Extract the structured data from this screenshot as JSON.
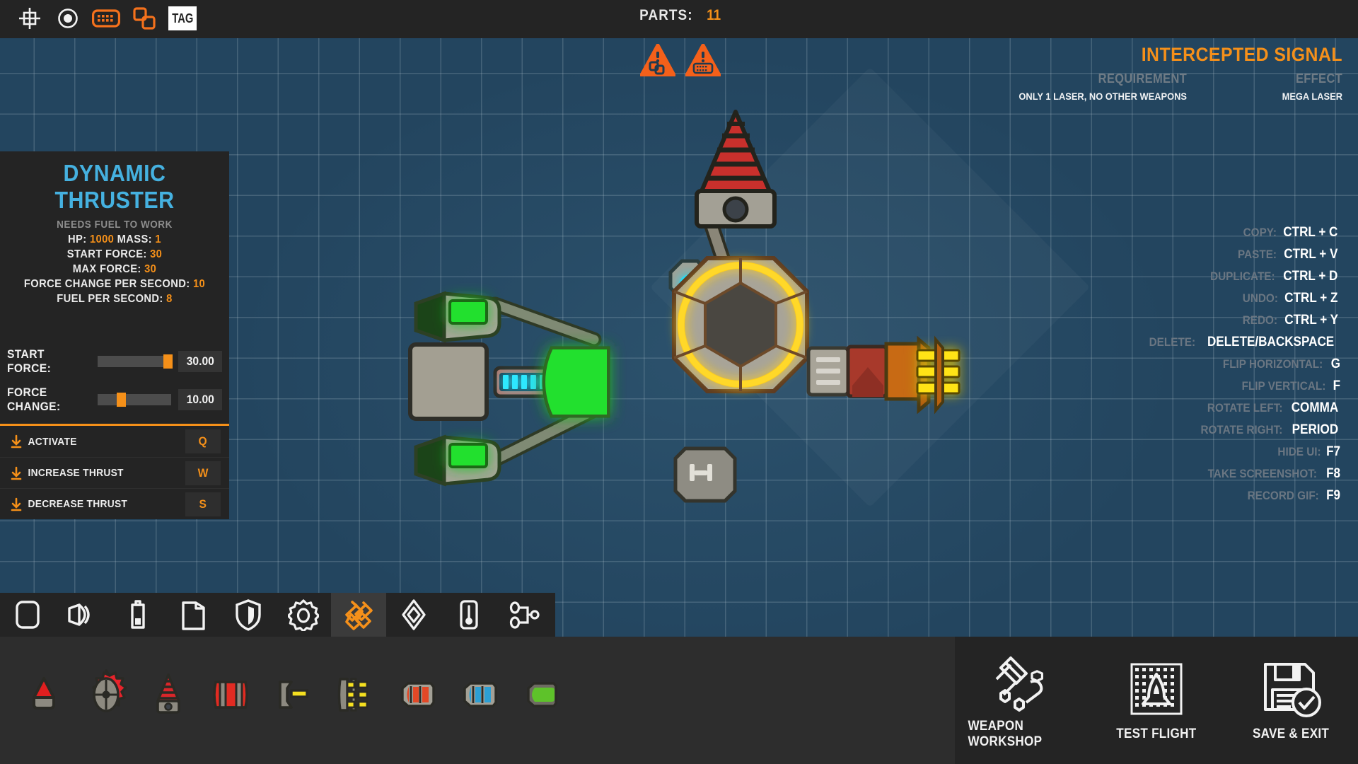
{
  "topbar": {
    "icons": [
      {
        "name": "grid-snap-icon",
        "active": false
      },
      {
        "name": "record-icon",
        "active": false
      },
      {
        "name": "keyboard-icon",
        "active": true
      },
      {
        "name": "duplicate-icon",
        "active": true
      },
      {
        "name": "tag-icon",
        "label": "TAG",
        "active": false
      }
    ],
    "parts_label": "PARTS:",
    "parts_value": "11"
  },
  "warnings": [
    {
      "name": "warning-duplicate-badge",
      "glyph": "duplicate"
    },
    {
      "name": "warning-keyboard-badge",
      "glyph": "keyboard"
    }
  ],
  "left_panel": {
    "title": "DYNAMIC THRUSTER",
    "subtitle": "NEEDS FUEL TO WORK",
    "stats": [
      {
        "label": "HP:",
        "value": "1000",
        "label2": "MASS:",
        "value2": "1"
      },
      {
        "label": "START FORCE:",
        "value": "30"
      },
      {
        "label": "MAX FORCE:",
        "value": "30"
      },
      {
        "label": "FORCE CHANGE PER SECOND:",
        "value": "10"
      },
      {
        "label": "FUEL PER SECOND:",
        "value": "8"
      }
    ],
    "sliders": [
      {
        "label": "START FORCE:",
        "value": "30.00",
        "percent": 92
      },
      {
        "label": "FORCE CHANGE:",
        "value": "10.00",
        "percent": 28
      }
    ],
    "bindings": [
      {
        "action": "ACTIVATE",
        "key": "Q"
      },
      {
        "action": "INCREASE THRUST",
        "key": "W"
      },
      {
        "action": "DECREASE THRUST",
        "key": "S"
      }
    ]
  },
  "signal": {
    "title": "INTERCEPTED SIGNAL",
    "requirement_header": "REQUIREMENT",
    "requirement_value": "ONLY 1 LASER,  NO OTHER WEAPONS",
    "effect_header": "EFFECT",
    "effect_value": "MEGA LASER"
  },
  "shortcuts": [
    {
      "name": "COPY:",
      "key": "CTRL + C"
    },
    {
      "name": "PASTE:",
      "key": "CTRL + V"
    },
    {
      "name": "DUPLICATE:",
      "key": "CTRL + D"
    },
    {
      "name": "UNDO:",
      "key": "CTRL + Z"
    },
    {
      "name": "REDO:",
      "key": "CTRL + Y"
    },
    {
      "name": "DELETE:",
      "key": "DELETE/BACKSPACE"
    },
    {
      "name": "FLIP HORIZONTAL:",
      "key": "G"
    },
    {
      "name": "FLIP VERTICAL:",
      "key": "F"
    },
    {
      "name": "ROTATE LEFT:",
      "key": "COMMA"
    },
    {
      "name": "ROTATE RIGHT:",
      "key": "PERIOD"
    },
    {
      "name": "HIDE UI:",
      "key": "F7"
    },
    {
      "name": "TAKE SCREENSHOT:",
      "key": "F8"
    },
    {
      "name": "RECORD GIF:",
      "key": "F9"
    }
  ],
  "toolbar": [
    {
      "name": "category-blocks",
      "icon": "rounded-square-icon",
      "active": false
    },
    {
      "name": "category-thrusters",
      "icon": "thruster-icon",
      "active": false
    },
    {
      "name": "category-power",
      "icon": "battery-icon",
      "active": false
    },
    {
      "name": "category-fuel",
      "icon": "fuel-can-icon",
      "active": false
    },
    {
      "name": "category-armor",
      "icon": "shield-icon",
      "active": false
    },
    {
      "name": "category-mechanics",
      "icon": "gear-icon",
      "active": false
    },
    {
      "name": "category-weapons",
      "icon": "weapons-icon",
      "active": true
    },
    {
      "name": "category-decor",
      "icon": "diamond-icon",
      "active": false
    },
    {
      "name": "category-sensors",
      "icon": "thermometer-icon",
      "active": false
    },
    {
      "name": "category-logic",
      "icon": "logic-node-icon",
      "active": false
    }
  ],
  "parts_tray": [
    {
      "name": "part-spike",
      "icon": "red-spike"
    },
    {
      "name": "part-mine",
      "icon": "red-mine"
    },
    {
      "name": "part-drill",
      "icon": "red-striped-cone"
    },
    {
      "name": "part-explosive-barrel",
      "icon": "red-barrel"
    },
    {
      "name": "part-laser-emitter",
      "icon": "yellow-laser"
    },
    {
      "name": "part-ammo-rack",
      "icon": "yellow-ammo"
    },
    {
      "name": "part-red-magazine",
      "icon": "red-magazine"
    },
    {
      "name": "part-blue-magazine",
      "icon": "blue-magazine"
    },
    {
      "name": "part-green-cell",
      "icon": "green-cell"
    }
  ],
  "tray_actions": [
    {
      "name": "weapon-workshop-button",
      "label": "WEAPON WORKSHOP",
      "icon": "hammer-wrench-icon"
    },
    {
      "name": "test-flight-button",
      "label": "TEST FLIGHT",
      "icon": "rocket-grid-icon"
    },
    {
      "name": "save-exit-button",
      "label": "SAVE & EXIT",
      "icon": "floppy-check-icon"
    }
  ],
  "colors": {
    "accent_orange": "#f59019",
    "title_blue": "#45b1e0",
    "canvas_blue": "#23455f",
    "panel_dark": "#242424",
    "tray_dark": "#2d2d2d"
  }
}
